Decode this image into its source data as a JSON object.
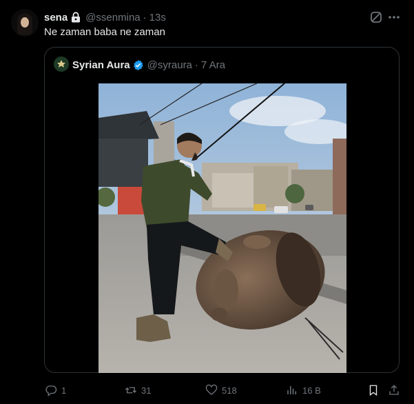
{
  "tweet": {
    "display_name": "sena",
    "handle": "@ssenmina",
    "separator": "·",
    "time": "13s",
    "text": "Ne zaman baba ne zaman"
  },
  "quoted_tweet": {
    "display_name": "Syrian Aura",
    "handle": "@syraura",
    "separator": "·",
    "date": "7 Ara"
  },
  "actions": {
    "replies": "1",
    "reposts": "31",
    "likes": "518",
    "views": "16 B"
  },
  "colors": {
    "background": "#000000",
    "text": "#e7e9ea",
    "muted": "#71767b",
    "border": "#2f3336",
    "verified": "#1d9bf0"
  },
  "icons": [
    "lock-icon",
    "grok-icon",
    "more-icon",
    "verified-icon",
    "reply-icon",
    "repost-icon",
    "like-icon",
    "views-icon",
    "bookmark-icon",
    "share-icon"
  ]
}
